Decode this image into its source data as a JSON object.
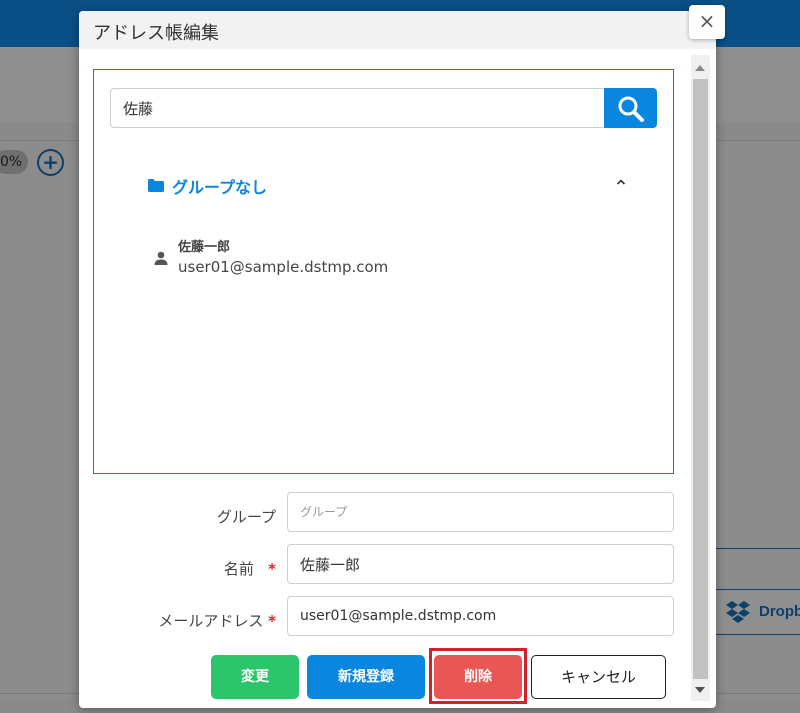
{
  "background": {
    "zoom_text": "0%",
    "zoom_in_symbol": "+",
    "dropbox_label": "Dropb"
  },
  "modal": {
    "title": "アドレス帳編集",
    "close_symbol": "×",
    "search": {
      "value": "佐藤"
    },
    "group": {
      "name": "グループなし",
      "expanded": true
    },
    "contacts": [
      {
        "name": "佐藤一郎",
        "email": "user01@sample.dstmp.com"
      }
    ],
    "form": {
      "group_label": "グループ",
      "group_placeholder": "グループ",
      "name_label": "名前",
      "name_value": "佐藤一郎",
      "email_label": "メールアドレス",
      "email_value": "user01@sample.dstmp.com",
      "required_mark": "*"
    },
    "buttons": {
      "change": "変更",
      "register": "新規登録",
      "delete": "削除",
      "cancel": "キャンセル"
    }
  },
  "colors": {
    "primary": "#0b86df",
    "success": "#2bc56b",
    "danger": "#ea5556",
    "highlight_outline": "#d51f2a"
  }
}
